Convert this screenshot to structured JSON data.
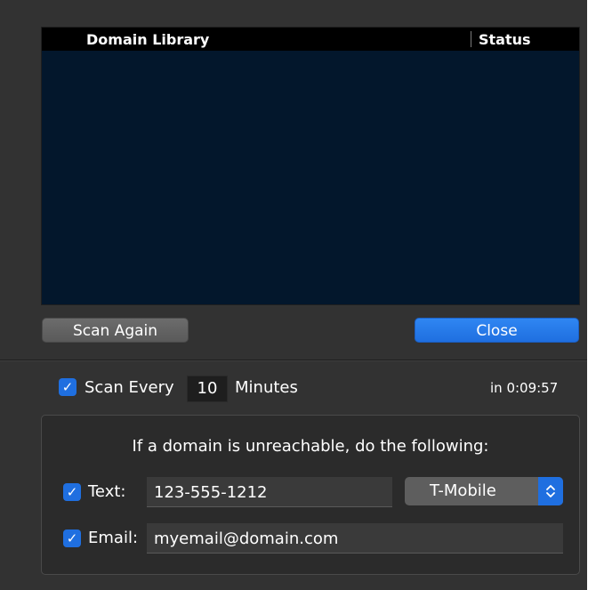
{
  "table": {
    "columns": [
      "Domain Library",
      "Status"
    ],
    "rows": []
  },
  "buttons": {
    "scan_again": "Scan Again",
    "close": "Close"
  },
  "schedule": {
    "checkbox_checked": true,
    "label": "Scan Every",
    "minutes_value": "10",
    "minutes_label": "Minutes",
    "countdown": "in 0:09:57"
  },
  "alerts": {
    "title": "If a domain is unreachable, do the following:",
    "text": {
      "checked": true,
      "label": "Text:",
      "value": "123-555-1212",
      "carrier": "T-Mobile"
    },
    "email": {
      "checked": true,
      "label": "Email:",
      "value": "myemail@domain.com"
    }
  },
  "colors": {
    "accent": "#1f6fe0",
    "table_bg": "#03172c",
    "window_bg": "#323232"
  },
  "icons": {
    "checkbox": "checkmark-icon",
    "select": "chevron-up-down-icon"
  }
}
